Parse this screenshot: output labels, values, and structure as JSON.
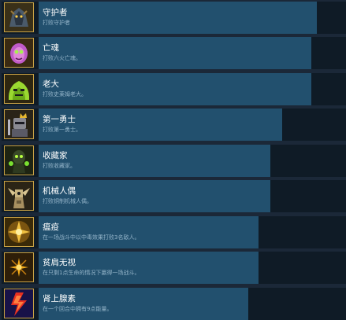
{
  "achievements": [
    {
      "name": "守护者",
      "desc": "打败守护者",
      "progress": 0.906,
      "icon": "guardian-icon"
    },
    {
      "name": "亡魂",
      "desc": "打败六火亡魂。",
      "progress": 0.886,
      "icon": "lost-soul-icon"
    },
    {
      "name": "老大",
      "desc": "打败史莱姆老大。",
      "progress": 0.886,
      "icon": "boss-slime-icon"
    },
    {
      "name": "第一勇士",
      "desc": "打败第一勇士。",
      "progress": 0.793,
      "icon": "first-warrior-icon"
    },
    {
      "name": "收藏家",
      "desc": "打败收藏家。",
      "progress": 0.754,
      "icon": "collector-icon"
    },
    {
      "name": "机械人偶",
      "desc": "打败铜制机械人偶。",
      "progress": 0.754,
      "icon": "automaton-icon"
    },
    {
      "name": "瘟疫",
      "desc": "在一场战斗中以中毒效果打败3名敌人。",
      "progress": 0.716,
      "icon": "plague-icon"
    },
    {
      "name": "贫肩无视",
      "desc": "在只剩1点生命的情况下赢得一场战斗。",
      "progress": 0.716,
      "icon": "one-hp-icon"
    },
    {
      "name": "肾上腺素",
      "desc": "在一个回合中拥有9点能量。",
      "progress": 0.682,
      "icon": "adrenaline-icon"
    }
  ]
}
